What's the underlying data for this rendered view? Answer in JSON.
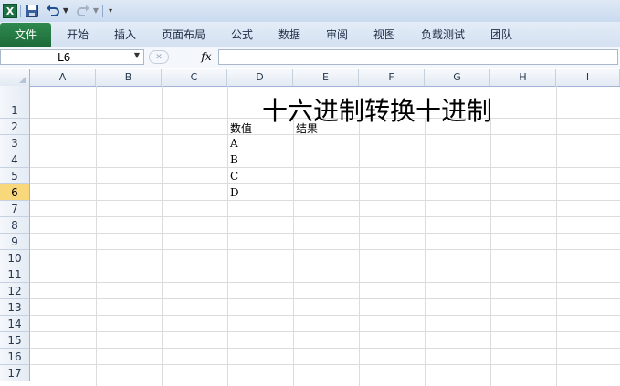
{
  "app": {
    "logo_letter": "X",
    "quick_access": {
      "save_icon": "save-icon",
      "undo_icon": "undo-icon",
      "redo_icon": "redo-icon"
    }
  },
  "ribbon": {
    "tabs": [
      "文件",
      "开始",
      "插入",
      "页面布局",
      "公式",
      "数据",
      "审阅",
      "视图",
      "负载测试",
      "团队"
    ]
  },
  "formula_bar": {
    "name_box": "L6",
    "fx_label": "fx",
    "formula_value": ""
  },
  "sheet": {
    "columns": [
      "A",
      "B",
      "C",
      "D",
      "E",
      "F",
      "G",
      "H",
      "I"
    ],
    "rows": [
      "1",
      "2",
      "3",
      "4",
      "5",
      "6",
      "7",
      "8",
      "9",
      "10",
      "11",
      "12",
      "13",
      "14",
      "15",
      "16",
      "17"
    ],
    "active_row": "6",
    "title": "十六进制转换十进制",
    "cells": {
      "D2": "数值",
      "E2": "结果",
      "D3": "A",
      "D4": "B",
      "D5": "C",
      "D6": "D"
    }
  },
  "colors": {
    "file_tab": "#1d6b3a",
    "active_row_header": "#f8d87b"
  }
}
